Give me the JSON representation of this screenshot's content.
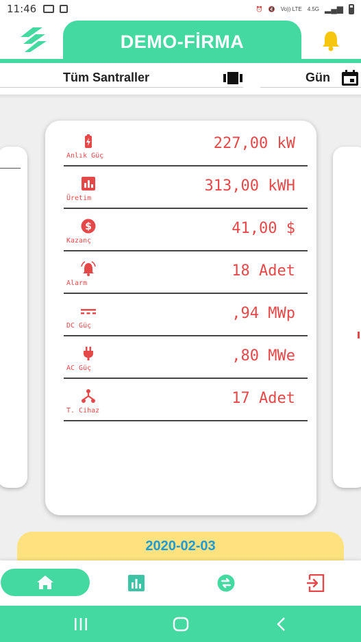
{
  "status_bar": {
    "time": "11:46",
    "network": "4.5G",
    "volte": "Vo)) LTE"
  },
  "header": {
    "title": "DEMO-FİRMA",
    "menu_icon": "stacked-stripes-logo-icon",
    "notification_icon": "bell-icon"
  },
  "filters": {
    "plant": "Tüm Santraller",
    "plant_icon": "carousel-icon",
    "period": "Gün",
    "period_icon": "calendar-icon"
  },
  "metrics": [
    {
      "label": "Anlık Güç",
      "value": "227,00 kW",
      "icon": "battery-charging-icon"
    },
    {
      "label": "Üretim",
      "value": "313,00 kWH",
      "icon": "bar-chart-icon"
    },
    {
      "label": "Kazanç",
      "value": "41,00 $",
      "icon": "dollar-icon"
    },
    {
      "label": "Alarm",
      "value": "18 Adet",
      "icon": "alarm-icon"
    },
    {
      "label": "DC Güç",
      "value": ",94 MWp",
      "icon": "dc-current-icon"
    },
    {
      "label": "AC Güç",
      "value": ",80 MWe",
      "icon": "power-plug-icon"
    },
    {
      "label": "T. Cihaz",
      "value": "17 Adet",
      "icon": "device-tree-icon"
    }
  ],
  "date": "2020-02-03",
  "bottom_nav": {
    "items": [
      "home-icon",
      "bar-chart-icon",
      "swap-icon",
      "logout-icon"
    ],
    "active": 0
  },
  "colors": {
    "accent": "#45d9a2",
    "metric": "#e54848",
    "date_bg": "#fde27f",
    "date_text": "#1d9bd6",
    "bell": "#f6c60e",
    "nav_chart": "#3fc3a6",
    "nav_swap": "#45d9a2",
    "nav_logout": "#e54848"
  }
}
